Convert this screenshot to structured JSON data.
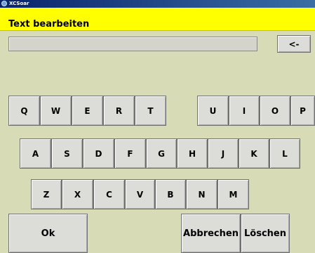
{
  "window": {
    "title": "XCSoar"
  },
  "dialog": {
    "caption": "Text bearbeiten",
    "text_value": ""
  },
  "keys": {
    "backspace": "<-",
    "Q": "Q",
    "W": "W",
    "E": "E",
    "R": "R",
    "T": "T",
    "U": "U",
    "I": "I",
    "O": "O",
    "P": "P",
    "A": "A",
    "S": "S",
    "D": "D",
    "F": "F",
    "G": "G",
    "H": "H",
    "J": "J",
    "K": "K",
    "L": "L",
    "Z": "Z",
    "X": "X",
    "C": "C",
    "V": "V",
    "B": "B",
    "N": "N",
    "M": "M"
  },
  "buttons": {
    "ok": "Ok",
    "cancel": "Abbrechen",
    "clear": "Löschen"
  }
}
